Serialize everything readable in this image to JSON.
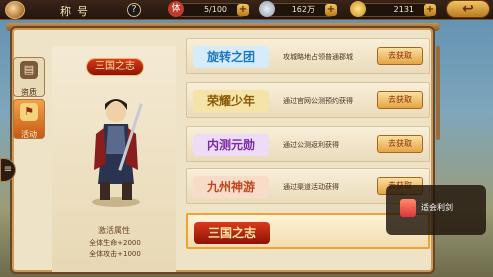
{
  "header": {
    "title": "称号",
    "help": "?",
    "stamina": {
      "value": "5/100",
      "icon": "stamina-icon"
    },
    "silver": {
      "value": "162万",
      "icon": "silver-coin-icon"
    },
    "gold": {
      "value": "2131",
      "icon": "gold-ingot-icon"
    },
    "plus": "+",
    "back": "↩"
  },
  "sidebar": {
    "tabs": [
      {
        "label": "资质",
        "icon": "book-icon",
        "active": false
      },
      {
        "label": "活动",
        "icon": "flag-icon",
        "active": true
      }
    ],
    "handle": "≡"
  },
  "character": {
    "title_badge": "三国之志",
    "attr_title": "激活属性",
    "attrs": [
      "全体生命+2000",
      "全体攻击+1000"
    ]
  },
  "titles": [
    {
      "name": "旋转之团",
      "desc": "攻城略地占领普通郡城",
      "button": "去获取",
      "color": "#1d77c2"
    },
    {
      "name": "荣耀少年",
      "desc": "通过官网公测预约获得",
      "button": "去获取",
      "color": "#c49a12"
    },
    {
      "name": "内测元勋",
      "desc": "通过公测返利获得",
      "button": "去获取",
      "color": "#7a2aa6"
    },
    {
      "name": "九州神游",
      "desc": "通过渠道活动获得",
      "button": "去获取",
      "color": "#c2461c"
    },
    {
      "name": "三国之志",
      "desc": "",
      "button": "",
      "color": "#c8321a"
    }
  ],
  "watermark": {
    "text": "适会利剑"
  }
}
